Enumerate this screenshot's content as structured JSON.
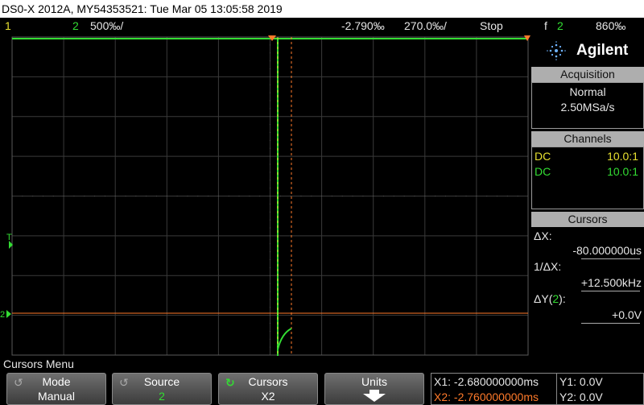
{
  "title_bar": "DS0-X 2012A, MY54353521: Tue Mar 05 13:05:58 2019",
  "status": {
    "ch1": "1",
    "ch2": "2",
    "ch2_scale": "500‰/",
    "time_offset": "-2.790‰",
    "time_scale": "270.0‰/",
    "run_state": "Stop",
    "trigger_icon": "f",
    "trigger_channel": "2",
    "trigger_level": "860‰"
  },
  "markers": {
    "trigger": "T",
    "ch2": "2"
  },
  "brand": {
    "name": "Agilent",
    "logo_icon": "agilent-spark-icon"
  },
  "acquisition": {
    "header": "Acquisition",
    "mode": "Normal",
    "rate": "2.50MSa/s"
  },
  "channels": {
    "header": "Channels",
    "ch1_coupling": "DC",
    "ch1_probe": "10.0:1",
    "ch2_coupling": "DC",
    "ch2_probe": "10.0:1"
  },
  "cursors": {
    "header": "Cursors",
    "dx_label": "ΔX:",
    "dx_value": "-80.000000us",
    "inv_dx_label": "1/ΔX:",
    "inv_dx_value": "+12.500kHz",
    "dy_label_pre": "ΔY(",
    "dy_label_ch": "2",
    "dy_label_post": "):",
    "dy_value": "+0.0V"
  },
  "menu": {
    "title": "Cursors Menu",
    "softkeys": [
      {
        "label": "Mode",
        "value": "Manual"
      },
      {
        "label": "Source",
        "value": "2"
      },
      {
        "label": "Cursors",
        "value": "X2"
      },
      {
        "label": "Units",
        "value": ""
      }
    ]
  },
  "readout": {
    "x1": "X1: -2.680000000ms",
    "x2": "X2: -2.760000000ms",
    "y1": "Y1: 0.0V",
    "y2": "Y2: 0.0V"
  },
  "colors": {
    "ch1": "#e8e030",
    "ch2": "#33dd33",
    "cursor": "#ff7a2a",
    "grid": "#444444"
  }
}
